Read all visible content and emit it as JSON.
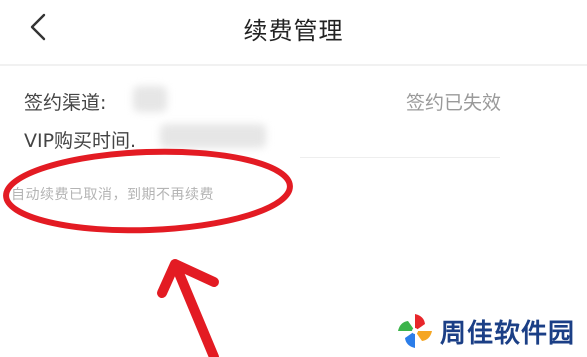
{
  "header": {
    "title": "续费管理",
    "back_icon": "chevron-left-icon"
  },
  "subscription": {
    "channel_label": "签约渠道:",
    "purchase_time_label": "VIP购买时间.",
    "status": "签约已失效",
    "notice": "自动续费已取消，到期不再续费"
  },
  "annotation": {
    "ellipse_color": "#e31b23",
    "arrow_color": "#e31b23"
  },
  "watermark": {
    "text": "周佳软件园"
  }
}
